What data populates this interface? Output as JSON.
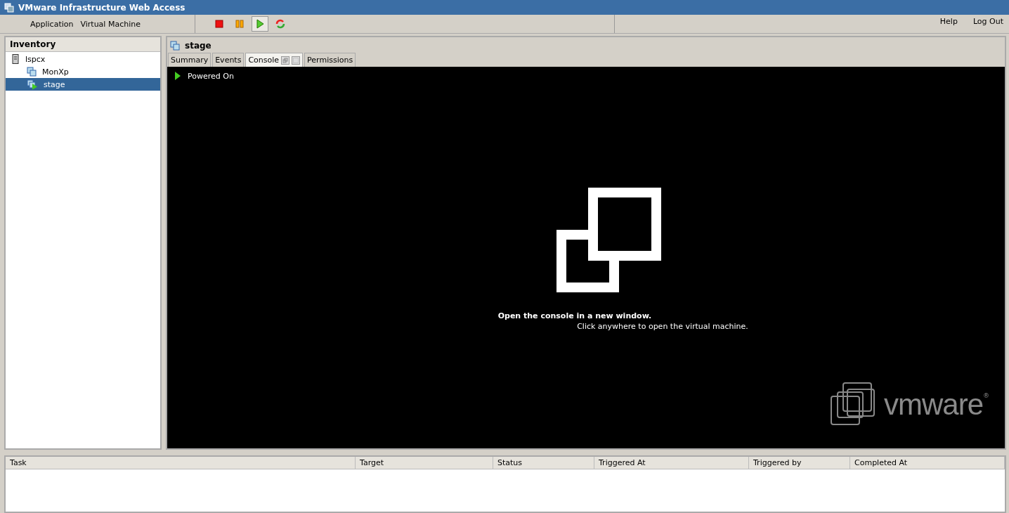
{
  "window": {
    "title": "VMware Infrastructure Web Access"
  },
  "menu": [
    "Application",
    "Virtual Machine"
  ],
  "toolbar": [
    {
      "kind": "stop",
      "selected": false
    },
    {
      "kind": "pause",
      "selected": false
    },
    {
      "kind": "play",
      "selected": true
    },
    {
      "kind": "reset",
      "selected": false
    }
  ],
  "top_links": [
    "Help",
    "Log Out"
  ],
  "inventory": {
    "title": "Inventory",
    "items": [
      {
        "label": "lspcx",
        "kind": "host",
        "selected": false,
        "children": [
          {
            "label": "MonXp",
            "kind": "vm",
            "selected": false
          },
          {
            "label": "stage",
            "kind": "vm-running",
            "selected": true
          }
        ]
      }
    ]
  },
  "vm": {
    "title": "stage",
    "tabs": [
      {
        "label": "Summary",
        "selected": false
      },
      {
        "label": "Events",
        "selected": false
      },
      {
        "label": "Console",
        "selected": true
      },
      {
        "label": "Permissions",
        "selected": false
      }
    ],
    "console": {
      "power_state": "Powered On",
      "message": "Open the console in a new window.",
      "hint": "Click anywhere to open the virtual machine.",
      "logo_text": "vmware",
      "logo_mark": "®"
    }
  },
  "tasks": {
    "columns": [
      "Task",
      "Target",
      "Status",
      "Triggered At",
      "Triggered by",
      "Completed At"
    ]
  }
}
